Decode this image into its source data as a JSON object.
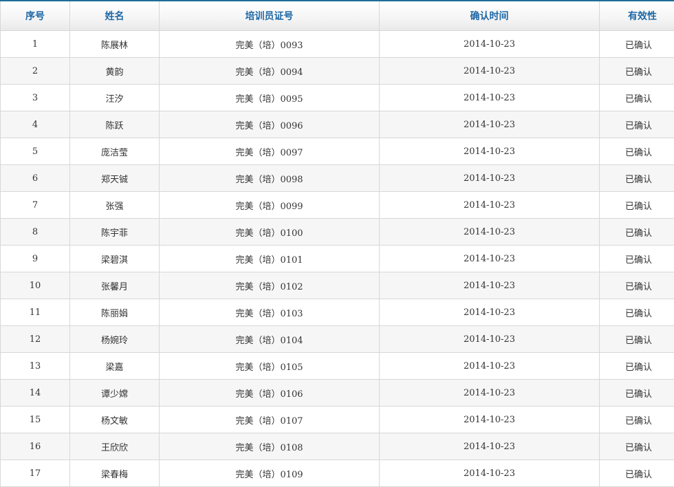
{
  "table": {
    "columns": [
      "序号",
      "姓名",
      "培训员证号",
      "确认时间",
      "有效性"
    ],
    "rows": [
      {
        "no": "1",
        "name": "陈展林",
        "cert_prefix": "完美（培）",
        "cert_num": "0093",
        "date": "2014-10-23",
        "status": "已确认"
      },
      {
        "no": "2",
        "name": "黄韵",
        "cert_prefix": "完美（培）",
        "cert_num": "0094",
        "date": "2014-10-23",
        "status": "已确认"
      },
      {
        "no": "3",
        "name": "汪汐",
        "cert_prefix": "完美（培）",
        "cert_num": "0095",
        "date": "2014-10-23",
        "status": "已确认"
      },
      {
        "no": "4",
        "name": "陈跃",
        "cert_prefix": "完美（培）",
        "cert_num": "0096",
        "date": "2014-10-23",
        "status": "已确认"
      },
      {
        "no": "5",
        "name": "庞洁莹",
        "cert_prefix": "完美（培）",
        "cert_num": "0097",
        "date": "2014-10-23",
        "status": "已确认"
      },
      {
        "no": "6",
        "name": "郑天铖",
        "cert_prefix": "完美（培）",
        "cert_num": "0098",
        "date": "2014-10-23",
        "status": "已确认"
      },
      {
        "no": "7",
        "name": "张强",
        "cert_prefix": "完美（培）",
        "cert_num": "0099",
        "date": "2014-10-23",
        "status": "已确认"
      },
      {
        "no": "8",
        "name": "陈宇菲",
        "cert_prefix": "完美（培）",
        "cert_num": "0100",
        "date": "2014-10-23",
        "status": "已确认"
      },
      {
        "no": "9",
        "name": "梁碧淇",
        "cert_prefix": "完美（培）",
        "cert_num": "0101",
        "date": "2014-10-23",
        "status": "已确认"
      },
      {
        "no": "10",
        "name": "张馨月",
        "cert_prefix": "完美（培）",
        "cert_num": "0102",
        "date": "2014-10-23",
        "status": "已确认"
      },
      {
        "no": "11",
        "name": "陈丽娟",
        "cert_prefix": "完美（培）",
        "cert_num": "0103",
        "date": "2014-10-23",
        "status": "已确认"
      },
      {
        "no": "12",
        "name": "杨婉玲",
        "cert_prefix": "完美（培）",
        "cert_num": "0104",
        "date": "2014-10-23",
        "status": "已确认"
      },
      {
        "no": "13",
        "name": "梁嘉",
        "cert_prefix": "完美（培）",
        "cert_num": "0105",
        "date": "2014-10-23",
        "status": "已确认"
      },
      {
        "no": "14",
        "name": "谭少嫦",
        "cert_prefix": "完美（培）",
        "cert_num": "0106",
        "date": "2014-10-23",
        "status": "已确认"
      },
      {
        "no": "15",
        "name": "杨文敏",
        "cert_prefix": "完美（培）",
        "cert_num": "0107",
        "date": "2014-10-23",
        "status": "已确认"
      },
      {
        "no": "16",
        "name": "王欣欣",
        "cert_prefix": "完美（培）",
        "cert_num": "0108",
        "date": "2014-10-23",
        "status": "已确认"
      },
      {
        "no": "17",
        "name": "梁春梅",
        "cert_prefix": "完美（培）",
        "cert_num": "0109",
        "date": "2014-10-23",
        "status": "已确认"
      }
    ]
  }
}
